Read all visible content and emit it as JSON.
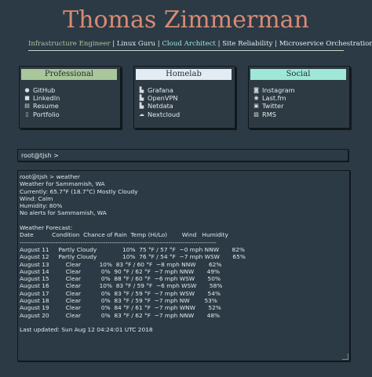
{
  "header": {
    "name": "Thomas Zimmerman",
    "tags": [
      "Infrastructure Engineer",
      "Linux Guru",
      "Cloud Architect",
      "Site Reliability",
      "Microservice Orchestration"
    ],
    "separator": "|"
  },
  "panels": [
    {
      "title": "Professional",
      "color": "#a9c79a",
      "items": [
        {
          "label": "GitHub",
          "icon": "github-icon"
        },
        {
          "label": "LinkedIn",
          "icon": "linkedin-icon"
        },
        {
          "label": "Resume",
          "icon": "document-icon"
        },
        {
          "label": "Portfolio",
          "icon": "file-icon"
        }
      ]
    },
    {
      "title": "Homelab",
      "color": "#e3ecf3",
      "items": [
        {
          "label": "Grafana",
          "icon": "bar-chart-icon"
        },
        {
          "label": "OpenVPN",
          "icon": "bar-chart-icon"
        },
        {
          "label": "Netdata",
          "icon": "bar-chart-icon"
        },
        {
          "label": "Nextcloud",
          "icon": "cloud-icon"
        }
      ]
    },
    {
      "title": "Social",
      "color": "#9fe8d8",
      "items": [
        {
          "label": "Instagram",
          "icon": "instagram-icon"
        },
        {
          "label": "Last.fm",
          "icon": "lastfm-icon"
        },
        {
          "label": "Twitter",
          "icon": "twitter-icon"
        },
        {
          "label": "RMS",
          "icon": "image-icon"
        }
      ]
    }
  ],
  "command": {
    "prompt": "root@tjsh >"
  },
  "terminal": {
    "lines": [
      "root@tjsh > weather",
      "Weather for Sammamish, WA",
      "Currently: 65.7°F (18.7°C) Mostly Cloudy",
      "Wind: Calm",
      "Humidity: 80%",
      "No alerts for Sammamish, WA",
      "",
      "Weather Forecast:",
      "Date          Condition  Chance of Rain  Temp (Hi/Lo)        Wind   Humidity",
      "----------------------------------------------------------------------------------------------",
      "August 11     Partly Cloudy              10%  75 °F / 57 °F  ~0 mph NNW       82%",
      "August 12     Partly Cloudy              10%  76 °F / 54 °F  ~7 mph WSW       65%",
      "August 13         Clear          10%  83 °F / 60 °F  ~8 mph NNW       62%",
      "August 14         Clear           0%  90 °F / 62 °F  ~7 mph NNW       49%",
      "August 15         Clear           0%  88 °F / 60 °F  ~6 mph WSW       50%",
      "August 16         Clear          10%  83 °F / 59 °F  ~6 mph WSW       58%",
      "August 17         Clear           0%  83 °F / 59 °F  ~7 mph WSW       54%",
      "August 18         Clear           0%  83 °F / 59 °F  ~7 mph NW        53%",
      "August 19         Clear           0%  84 °F / 61 °F  ~7 mph WNW       52%",
      "August 20         Clear           0%  83 °F / 62 °F  ~7 mph NNW       48%",
      "",
      "Last updated: Sun Aug 12 04:24:01 UTC 2018"
    ]
  }
}
